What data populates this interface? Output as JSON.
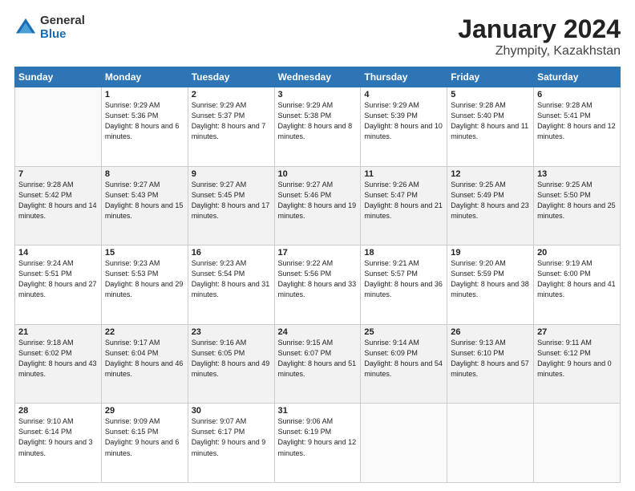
{
  "logo": {
    "general": "General",
    "blue": "Blue"
  },
  "header": {
    "month_year": "January 2024",
    "location": "Zhympity, Kazakhstan"
  },
  "weekdays": [
    "Sunday",
    "Monday",
    "Tuesday",
    "Wednesday",
    "Thursday",
    "Friday",
    "Saturday"
  ],
  "weeks": [
    [
      {
        "day": "",
        "empty": true
      },
      {
        "day": "1",
        "sunrise": "Sunrise: 9:29 AM",
        "sunset": "Sunset: 5:36 PM",
        "daylight": "Daylight: 8 hours and 6 minutes."
      },
      {
        "day": "2",
        "sunrise": "Sunrise: 9:29 AM",
        "sunset": "Sunset: 5:37 PM",
        "daylight": "Daylight: 8 hours and 7 minutes."
      },
      {
        "day": "3",
        "sunrise": "Sunrise: 9:29 AM",
        "sunset": "Sunset: 5:38 PM",
        "daylight": "Daylight: 8 hours and 8 minutes."
      },
      {
        "day": "4",
        "sunrise": "Sunrise: 9:29 AM",
        "sunset": "Sunset: 5:39 PM",
        "daylight": "Daylight: 8 hours and 10 minutes."
      },
      {
        "day": "5",
        "sunrise": "Sunrise: 9:28 AM",
        "sunset": "Sunset: 5:40 PM",
        "daylight": "Daylight: 8 hours and 11 minutes."
      },
      {
        "day": "6",
        "sunrise": "Sunrise: 9:28 AM",
        "sunset": "Sunset: 5:41 PM",
        "daylight": "Daylight: 8 hours and 12 minutes."
      }
    ],
    [
      {
        "day": "7",
        "sunrise": "Sunrise: 9:28 AM",
        "sunset": "Sunset: 5:42 PM",
        "daylight": "Daylight: 8 hours and 14 minutes."
      },
      {
        "day": "8",
        "sunrise": "Sunrise: 9:27 AM",
        "sunset": "Sunset: 5:43 PM",
        "daylight": "Daylight: 8 hours and 15 minutes."
      },
      {
        "day": "9",
        "sunrise": "Sunrise: 9:27 AM",
        "sunset": "Sunset: 5:45 PM",
        "daylight": "Daylight: 8 hours and 17 minutes."
      },
      {
        "day": "10",
        "sunrise": "Sunrise: 9:27 AM",
        "sunset": "Sunset: 5:46 PM",
        "daylight": "Daylight: 8 hours and 19 minutes."
      },
      {
        "day": "11",
        "sunrise": "Sunrise: 9:26 AM",
        "sunset": "Sunset: 5:47 PM",
        "daylight": "Daylight: 8 hours and 21 minutes."
      },
      {
        "day": "12",
        "sunrise": "Sunrise: 9:25 AM",
        "sunset": "Sunset: 5:49 PM",
        "daylight": "Daylight: 8 hours and 23 minutes."
      },
      {
        "day": "13",
        "sunrise": "Sunrise: 9:25 AM",
        "sunset": "Sunset: 5:50 PM",
        "daylight": "Daylight: 8 hours and 25 minutes."
      }
    ],
    [
      {
        "day": "14",
        "sunrise": "Sunrise: 9:24 AM",
        "sunset": "Sunset: 5:51 PM",
        "daylight": "Daylight: 8 hours and 27 minutes."
      },
      {
        "day": "15",
        "sunrise": "Sunrise: 9:23 AM",
        "sunset": "Sunset: 5:53 PM",
        "daylight": "Daylight: 8 hours and 29 minutes."
      },
      {
        "day": "16",
        "sunrise": "Sunrise: 9:23 AM",
        "sunset": "Sunset: 5:54 PM",
        "daylight": "Daylight: 8 hours and 31 minutes."
      },
      {
        "day": "17",
        "sunrise": "Sunrise: 9:22 AM",
        "sunset": "Sunset: 5:56 PM",
        "daylight": "Daylight: 8 hours and 33 minutes."
      },
      {
        "day": "18",
        "sunrise": "Sunrise: 9:21 AM",
        "sunset": "Sunset: 5:57 PM",
        "daylight": "Daylight: 8 hours and 36 minutes."
      },
      {
        "day": "19",
        "sunrise": "Sunrise: 9:20 AM",
        "sunset": "Sunset: 5:59 PM",
        "daylight": "Daylight: 8 hours and 38 minutes."
      },
      {
        "day": "20",
        "sunrise": "Sunrise: 9:19 AM",
        "sunset": "Sunset: 6:00 PM",
        "daylight": "Daylight: 8 hours and 41 minutes."
      }
    ],
    [
      {
        "day": "21",
        "sunrise": "Sunrise: 9:18 AM",
        "sunset": "Sunset: 6:02 PM",
        "daylight": "Daylight: 8 hours and 43 minutes."
      },
      {
        "day": "22",
        "sunrise": "Sunrise: 9:17 AM",
        "sunset": "Sunset: 6:04 PM",
        "daylight": "Daylight: 8 hours and 46 minutes."
      },
      {
        "day": "23",
        "sunrise": "Sunrise: 9:16 AM",
        "sunset": "Sunset: 6:05 PM",
        "daylight": "Daylight: 8 hours and 49 minutes."
      },
      {
        "day": "24",
        "sunrise": "Sunrise: 9:15 AM",
        "sunset": "Sunset: 6:07 PM",
        "daylight": "Daylight: 8 hours and 51 minutes."
      },
      {
        "day": "25",
        "sunrise": "Sunrise: 9:14 AM",
        "sunset": "Sunset: 6:09 PM",
        "daylight": "Daylight: 8 hours and 54 minutes."
      },
      {
        "day": "26",
        "sunrise": "Sunrise: 9:13 AM",
        "sunset": "Sunset: 6:10 PM",
        "daylight": "Daylight: 8 hours and 57 minutes."
      },
      {
        "day": "27",
        "sunrise": "Sunrise: 9:11 AM",
        "sunset": "Sunset: 6:12 PM",
        "daylight": "Daylight: 9 hours and 0 minutes."
      }
    ],
    [
      {
        "day": "28",
        "sunrise": "Sunrise: 9:10 AM",
        "sunset": "Sunset: 6:14 PM",
        "daylight": "Daylight: 9 hours and 3 minutes."
      },
      {
        "day": "29",
        "sunrise": "Sunrise: 9:09 AM",
        "sunset": "Sunset: 6:15 PM",
        "daylight": "Daylight: 9 hours and 6 minutes."
      },
      {
        "day": "30",
        "sunrise": "Sunrise: 9:07 AM",
        "sunset": "Sunset: 6:17 PM",
        "daylight": "Daylight: 9 hours and 9 minutes."
      },
      {
        "day": "31",
        "sunrise": "Sunrise: 9:06 AM",
        "sunset": "Sunset: 6:19 PM",
        "daylight": "Daylight: 9 hours and 12 minutes."
      },
      {
        "day": "",
        "empty": true
      },
      {
        "day": "",
        "empty": true
      },
      {
        "day": "",
        "empty": true
      }
    ]
  ]
}
